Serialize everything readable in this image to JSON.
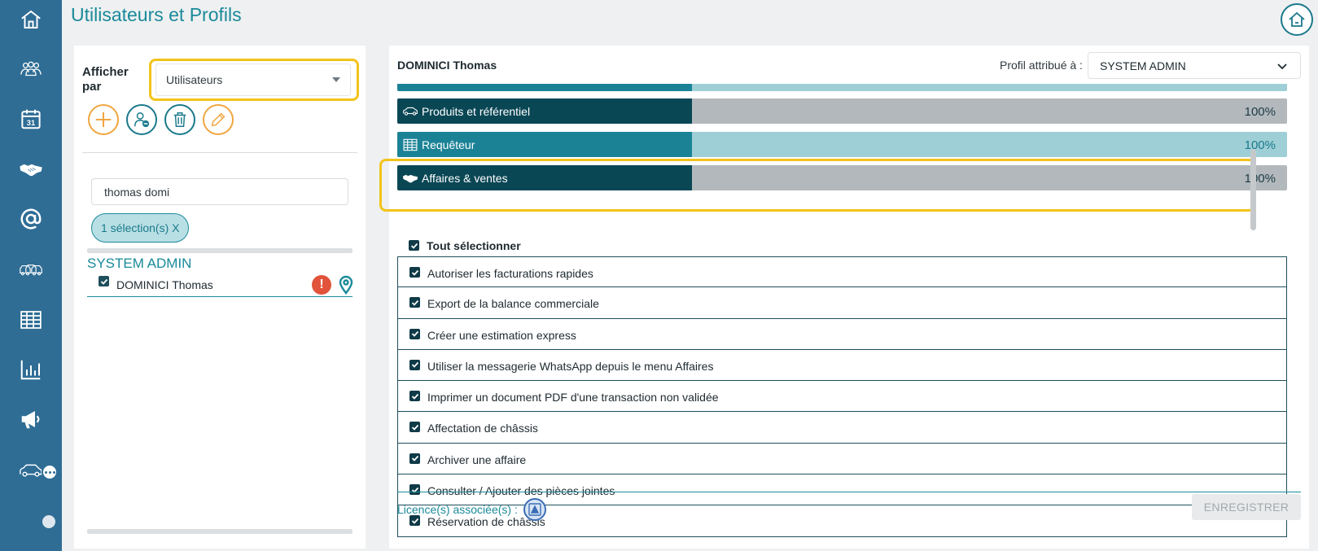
{
  "page": {
    "title": "Utilisateurs et Profils"
  },
  "nav": {
    "items": [
      "home-icon",
      "users-icon",
      "calendar-icon",
      "handshake-icon",
      "at-icon",
      "vehicles-icon",
      "table-icon",
      "chart-icon",
      "megaphone-icon",
      "car-chat-icon"
    ],
    "calendar_day": "31"
  },
  "left": {
    "afficher_par": "Afficher par",
    "view_select": "Utilisateurs",
    "search_value": "thomas domi",
    "selection_chip": "1 sélection(s) X",
    "group": "SYSTEM ADMIN",
    "user": "DOMINICI Thomas",
    "warning_mark": "!"
  },
  "right": {
    "user_name": "DOMINICI Thomas",
    "profil_label": "Profil attribué à :",
    "profil_value": "SYSTEM ADMIN",
    "categories": [
      {
        "name": "Produits et référentiel",
        "percent": "100%",
        "icon": "car-icon"
      },
      {
        "name": "Requêteur",
        "percent": "100%",
        "icon": "table-icon"
      },
      {
        "name": "Affaires & ventes",
        "percent": "100%",
        "icon": "handshake-icon"
      }
    ],
    "select_all": "Tout sélectionner",
    "permissions": [
      "Autoriser les facturations rapides",
      "Export de la balance commerciale",
      "Créer une estimation express",
      "Utiliser la messagerie WhatsApp depuis le menu Affaires",
      "Imprimer un document PDF d'une transaction non validée",
      "Affectation de châssis",
      "Archiver une affaire",
      "Consulter / Ajouter des pièces jointes",
      "Réservation de châssis"
    ],
    "licence_label": "Licence(s) associée(s) :",
    "save_label": "ENREGISTRER"
  },
  "colors": {
    "nav_bg": "#2f6d95",
    "accent_teal": "#1a8a9a",
    "dark_teal": "#0a4755",
    "highlight": "#f3c31b",
    "warning": "#e1533a"
  }
}
